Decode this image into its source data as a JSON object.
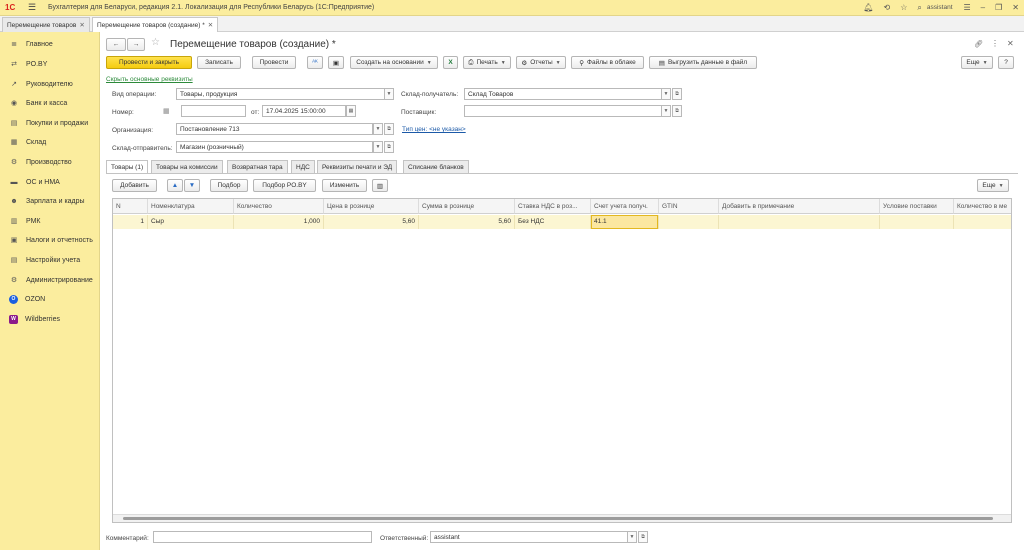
{
  "titlebar": {
    "logo": "1С",
    "title": "Бухгалтерия для Беларуси, редакция 2.1. Локализация для Республики Беларусь   (1С:Предприятие)",
    "user": "assistant"
  },
  "window_tabs": [
    {
      "label": "Перемещение товаров"
    },
    {
      "label": "Перемещение товаров (создание) *"
    }
  ],
  "sidebar": {
    "items": [
      {
        "label": "Главное",
        "icon": "≣"
      },
      {
        "label": "PO.BY",
        "icon": "⇄"
      },
      {
        "label": "Руководителю",
        "icon": "↗"
      },
      {
        "label": "Банк и касса",
        "icon": "◉"
      },
      {
        "label": "Покупки и продажи",
        "icon": "▤"
      },
      {
        "label": "Склад",
        "icon": "▦"
      },
      {
        "label": "Производство",
        "icon": "⚙"
      },
      {
        "label": "ОС и НМА",
        "icon": "▬"
      },
      {
        "label": "Зарплата и кадры",
        "icon": "☻"
      },
      {
        "label": "РМК",
        "icon": "▥"
      },
      {
        "label": "Налоги и отчетность",
        "icon": "▣"
      },
      {
        "label": "Настройки учета",
        "icon": "▤"
      },
      {
        "label": "Администрирование",
        "icon": "⚙"
      },
      {
        "label": "OZON",
        "icon": "O"
      },
      {
        "label": "Wildberries",
        "icon": "W"
      }
    ]
  },
  "doc": {
    "title": "Перемещение товаров (создание) *",
    "more": "Еще",
    "help": "?"
  },
  "toolbar": {
    "post_close": "Провести и закрыть",
    "save": "Записать",
    "post": "Провести",
    "create_based": "Создать на основании",
    "print": "Печать",
    "reports": "Отчеты",
    "cloud_files": "Файлы в облаке",
    "export": "Выгрузить данные в файл",
    "more": "Еще"
  },
  "form": {
    "hide_link": "Скрыть основные реквизиты",
    "op_label": "Вид операции:",
    "op_value": "Товары, продукция",
    "num_label": "Номер:",
    "num_value": "",
    "date_from": "от:",
    "date_value": "17.04.2025 15:00:00",
    "org_label": "Организация:",
    "org_value": "Постановление 713",
    "sender_label": "Склад-отправитель:",
    "sender_value": "Магазин (розничный)",
    "recv_label": "Склад-получатель:",
    "recv_value": "Склад Товаров",
    "supplier_label": "Поставщик:",
    "supplier_value": "",
    "price_type_link": "Тип цен: <не указан>"
  },
  "form_tabs": [
    {
      "label": "Товары (1)"
    },
    {
      "label": "Товары на комиссии"
    },
    {
      "label": "Возвратная тара"
    },
    {
      "label": "НДС"
    },
    {
      "label": "Реквизиты печати и ЭД"
    },
    {
      "label": "Списание бланков"
    }
  ],
  "table_toolbar": {
    "add": "Добавить",
    "pick": "Подбор",
    "pick_po": "Подбор PO.BY",
    "change": "Изменить",
    "more": "Еще"
  },
  "table": {
    "columns": [
      "N",
      "Номенклатура",
      "Количество",
      "Цена в рознице",
      "Сумма в рознице",
      "Ставка НДС в роз...",
      "Счет учета получ.",
      "GTIN",
      "Добавить в примечание",
      "Условие поставки",
      "Количество в ме"
    ],
    "rows": [
      [
        "1",
        "Сыр",
        "1,000",
        "5,60",
        "5,60",
        "Без НДС",
        "41.1",
        "",
        "",
        "",
        ""
      ]
    ]
  },
  "footer": {
    "comment_label": "Комментарий:",
    "comment_value": "",
    "resp_label": "Ответственный:",
    "resp_value": "assistant"
  }
}
